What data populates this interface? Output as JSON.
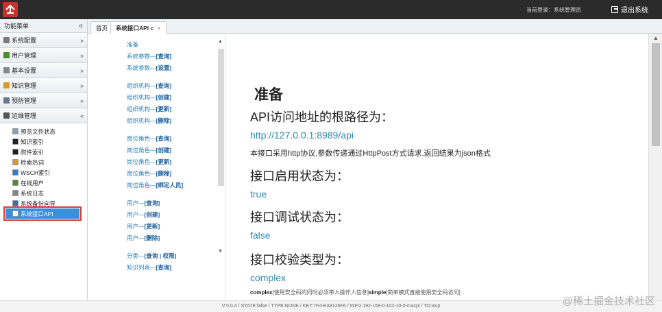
{
  "topbar": {
    "login_label": "当前登录：系统管理员",
    "logout_label": "退出系统"
  },
  "sidebar": {
    "header": "功能菜单",
    "collapse_glyph": "«",
    "groups": [
      {
        "label": "系统配置",
        "icon": "gear-icon",
        "color": "#7a7a7a",
        "chevron": "»"
      },
      {
        "label": "用户管理",
        "icon": "users-icon",
        "color": "#4a8c2a",
        "chevron": "»"
      },
      {
        "label": "基本设置",
        "icon": "settings-icon",
        "color": "#8a8a8a",
        "chevron": "»"
      },
      {
        "label": "知识管理",
        "icon": "book-icon",
        "color": "#d49a2a",
        "chevron": "»"
      },
      {
        "label": "预防管理",
        "icon": "document-icon",
        "color": "#6b7a8a",
        "chevron": "»"
      },
      {
        "label": "运维管理",
        "icon": "monitor-icon",
        "color": "#555555",
        "chevron": "«"
      }
    ],
    "sub_items": [
      {
        "label": "预览文件状态",
        "icon": "file-preview-icon",
        "color": "#8aa0b8"
      },
      {
        "label": "知识索引",
        "icon": "index-icon",
        "color": "#222222"
      },
      {
        "label": "附件索引",
        "icon": "attachment-index-icon",
        "color": "#222222"
      },
      {
        "label": "检索热词",
        "icon": "search-hotword-icon",
        "color": "#d49a2a"
      },
      {
        "label": "WSCH索引",
        "icon": "globe-icon",
        "color": "#2a7fd4"
      },
      {
        "label": "在线用户",
        "icon": "online-user-icon",
        "color": "#4a8c2a"
      },
      {
        "label": "系统日志",
        "icon": "log-icon",
        "color": "#888888"
      },
      {
        "label": "系统备份向导",
        "icon": "backup-icon",
        "color": "#3a6fb0"
      },
      {
        "label": "系统接口API",
        "icon": "api-icon",
        "color": "#ffffff"
      }
    ]
  },
  "tabs": {
    "home": "首页",
    "api": "系统接口API",
    "api_suffix": "c",
    "close": "×"
  },
  "api_nav": [
    {
      "prefix": "准备",
      "action": ""
    },
    {
      "prefix": "系统参数—",
      "action": "[查询]"
    },
    {
      "prefix": "系统参数—",
      "action": "[设置]"
    },
    {
      "prefix": "组织机构—",
      "action": "[查询]"
    },
    {
      "prefix": "组织机构—",
      "action": "[创建]"
    },
    {
      "prefix": "组织机构—",
      "action": "[更新]"
    },
    {
      "prefix": "组织机构—",
      "action": "[删除]"
    },
    {
      "prefix": "岗位角色—",
      "action": "[查询]"
    },
    {
      "prefix": "岗位角色—",
      "action": "[创建]"
    },
    {
      "prefix": "岗位角色—",
      "action": "[更新]"
    },
    {
      "prefix": "岗位角色—",
      "action": "[删除]"
    },
    {
      "prefix": "岗位角色—",
      "action": "[绑定人员]"
    },
    {
      "prefix": "用户—",
      "action": "[查询]"
    },
    {
      "prefix": "用户—",
      "action": "[创建]"
    },
    {
      "prefix": "用户—",
      "action": "[更新]"
    },
    {
      "prefix": "用户—",
      "action": "[删除]"
    },
    {
      "prefix": "分类—",
      "action": "[查询 | 权限]"
    },
    {
      "prefix": "知识列表—",
      "action": "[查询]"
    }
  ],
  "content": {
    "title": "准备",
    "sec1": "API访问地址的根路径为：",
    "url": "http://127.0.0.1:8989/api",
    "desc": "本接口采用http协议,参数传递通过HttpPost方式请求,返回结果为json格式",
    "sec2": "接口启用状态为：",
    "val2": "true",
    "sec3": "接口调试状态为：",
    "val3": "false",
    "sec4": "接口校验类型为：",
    "val4": "complex",
    "note_bold1": "complex",
    "note_text1": "[使用安全码的同时必须带入操作人信息]",
    "note_bold2": "simple",
    "note_text2": "[简单模式直接使用安全码访问]"
  },
  "footer": "V:5.0.4 / STATE:false / TYPE:NONE / KEY:7F4-EA8126F6 / INFO:192-168-0-102-10-0-macpl / TO:wcp",
  "watermark": "@稀土掘金技术社区"
}
